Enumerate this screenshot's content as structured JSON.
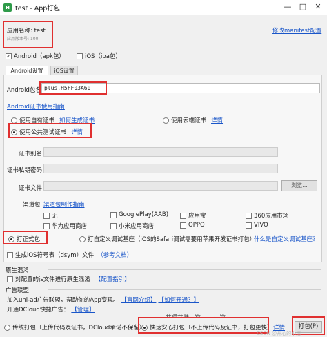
{
  "window": {
    "title": "test - App打包",
    "app_icon_text": "H",
    "minimize_glyph": "—",
    "maximize_glyph": "□",
    "close_glyph": "✕"
  },
  "app": {
    "name_label": "应用名称: test",
    "version_label": "应用版本号: 100",
    "modify_manifest_link": "修改manifest配置"
  },
  "platforms": {
    "android_label": "Android（apk包）",
    "android_checked": true,
    "ios_label": "iOS（ipa包）",
    "ios_checked": false
  },
  "tabs": [
    {
      "label": "Android设置",
      "active": true
    },
    {
      "label": "iOS设置",
      "active": false
    }
  ],
  "android": {
    "package_label": "Android包名",
    "package_value": "plus.H5FF03A60",
    "cert_guide_link": "Android证书使用指南",
    "cert_options": {
      "own_label": "使用自有证书",
      "own_help_link": "如何生成证书",
      "cloud_label": "使用云端证书",
      "cloud_detail_link": "详情",
      "public_label": "使用公共测试证书",
      "public_detail_link": "详情",
      "selected": "public"
    },
    "alias_label": "证书别名",
    "password_label": "证书私钥密码",
    "file_label": "证书文件",
    "browse_label": "浏览...",
    "channel_label": "渠道包",
    "channel_guide_link": "渠道包制作指南",
    "channels": [
      {
        "label": "无",
        "checked": false
      },
      {
        "label": "GooglePlay(AAB)",
        "checked": false
      },
      {
        "label": "应用宝",
        "checked": false
      },
      {
        "label": "360应用市场",
        "checked": false
      },
      {
        "label": "华为应用商店",
        "checked": false
      },
      {
        "label": "小米应用商店",
        "checked": false
      },
      {
        "label": "OPPO",
        "checked": false
      },
      {
        "label": "VIVO",
        "checked": false
      }
    ]
  },
  "build_type": {
    "formal_label": "打正式包",
    "custom_label": "打自定义调试基座（iOS的Safari调试需要用苹果开发证书打包）",
    "custom_help_link": "什么是自定义调试基座？",
    "selected": "formal"
  },
  "dsym": {
    "label": "生成iOS符号表（dsym）文件",
    "ref_link": "（参考文档）"
  },
  "obfuscation": {
    "title": "原生混淆",
    "label": "对配置的js文件进行原生混淆",
    "config_link": "【配置指引】"
  },
  "ads": {
    "title": "广告联盟",
    "join_text": "加入uni-ad广告联盟，帮助你的App变现。",
    "official_intro_link": "【官网介绍】",
    "how_to_open_link": "【如何开通？】",
    "open_text": "开通DCloud快捷广告：",
    "manage_link": "【管理】",
    "partial_row_text": "开通开屏广告",
    "partial_row_text_2": "广告"
  },
  "footer": {
    "traditional_label": "传统打包（上传代码及证书，DCloud承诺不保留）",
    "safe_label": "快速安心打包（不上传代码及证书，打包更快）",
    "safe_detail_link": "详情",
    "selected": "safe",
    "pack_button": "打包(P)",
    "watermark": "CSDN @开心的小洁"
  }
}
